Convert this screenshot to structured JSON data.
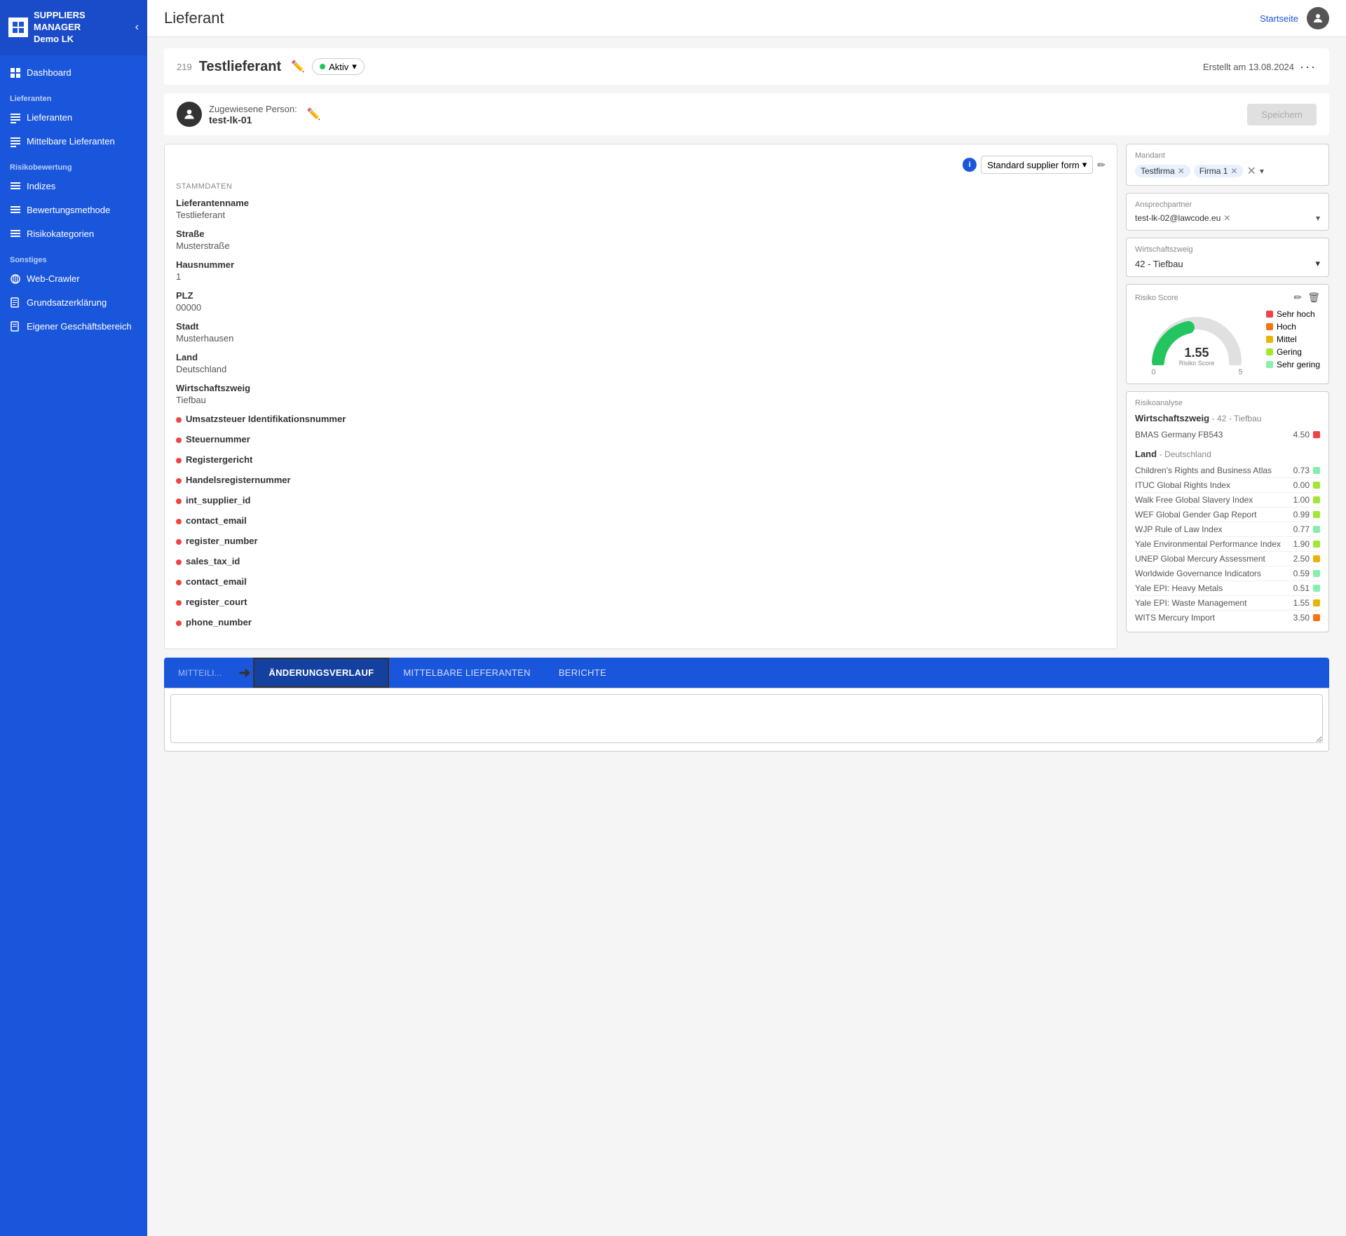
{
  "sidebar": {
    "app_name_line1": "SUPPLIERS",
    "app_name_line2": "MANAGER",
    "app_name_line3": "Demo LK",
    "collapse_icon": "‹",
    "nav": {
      "dashboard": "Dashboard",
      "section_lieferanten": "Lieferanten",
      "lieferanten": "Lieferanten",
      "mittelbare_lieferanten": "Mittelbare Lieferanten",
      "section_risikobewertung": "Risikobewertung",
      "indizes": "Indizes",
      "bewertungsmethode": "Bewertungsmethode",
      "risikokategorien": "Risikokategorien",
      "section_sonstiges": "Sonstiges",
      "web_crawler": "Web-Crawler",
      "grundsatzerklaerung": "Grundsatzerklärung",
      "eigener_geschaeftsbereich": "Eigener Geschäftsbereich"
    }
  },
  "topbar": {
    "title": "Lieferant",
    "link_startseite": "Startseite"
  },
  "supplier": {
    "id": "219",
    "name": "Testlieferant",
    "status": "Aktiv",
    "created_label": "Erstellt am 13.08.2024"
  },
  "assigned": {
    "label": "Zugewiesene Person:",
    "name": "test-lk-01"
  },
  "save_button": "Speichern",
  "form": {
    "section_label": "STAMMDATEN",
    "form_select_label": "Standard supplier form",
    "fields": [
      {
        "label": "Lieferantenname",
        "value": "Testlieferant",
        "required": false
      },
      {
        "label": "Straße",
        "value": "Musterstraße",
        "required": false
      },
      {
        "label": "Hausnummer",
        "value": "1",
        "required": false
      },
      {
        "label": "PLZ",
        "value": "00000",
        "required": false
      },
      {
        "label": "Stadt",
        "value": "Musterhausen",
        "required": false
      },
      {
        "label": "Land",
        "value": "Deutschland",
        "required": false
      },
      {
        "label": "Wirtschaftszweig",
        "value": "Tiefbau",
        "required": false
      }
    ],
    "required_fields": [
      "Umsatzsteuer Identifikationsnummer",
      "Steuernummer",
      "Registergericht",
      "Handelsregisternummer",
      "int_supplier_id",
      "contact_email",
      "register_number",
      "sales_tax_id",
      "contact_email",
      "register_court",
      "phone_number"
    ]
  },
  "right_panel": {
    "mandant_label": "Mandant",
    "mandant_tags": [
      "Testfirma",
      "Firma 1"
    ],
    "ansprechpartner_label": "Ansprechpartner",
    "ansprechpartner_value": "test-lk-02@lawcode.eu",
    "wirtschaftszweig_label": "Wirtschaftszweig",
    "wirtschaftszweig_value": "42 - Tiefbau",
    "risiko_score_label": "Risiko Score",
    "gauge_value": "1.55",
    "gauge_subtitle": "Risiko Score",
    "gauge_min": "0",
    "gauge_max": "5",
    "legend": [
      {
        "label": "Sehr hoch",
        "color": "#ef4444"
      },
      {
        "label": "Hoch",
        "color": "#f97316"
      },
      {
        "label": "Mittel",
        "color": "#eab308"
      },
      {
        "label": "Gering",
        "color": "#a3e635"
      },
      {
        "label": "Sehr gering",
        "color": "#86efac"
      }
    ],
    "risikoanalyse_label": "Risikoanalyse",
    "wirtschaftszweig_section": "Wirtschaftszweig",
    "wirtschaftszweig_section_sub": "42 - Tiefbau",
    "wirtschaftszweig_rows": [
      {
        "name": "BMAS Germany FB543",
        "value": "4.50",
        "color": "#ef4444"
      }
    ],
    "land_section": "Land",
    "land_section_sub": "Deutschland",
    "land_rows": [
      {
        "name": "Children's Rights and Business Atlas",
        "value": "0.73",
        "color": "#86efac"
      },
      {
        "name": "ITUC Global Rights Index",
        "value": "0.00",
        "color": "#a3e635"
      },
      {
        "name": "Walk Free Global Slavery Index",
        "value": "1.00",
        "color": "#a3e635"
      },
      {
        "name": "WEF Global Gender Gap Report",
        "value": "0.99",
        "color": "#a3e635"
      },
      {
        "name": "WJP Rule of Law Index",
        "value": "0.77",
        "color": "#86efac"
      },
      {
        "name": "Yale Environmental Performance Index",
        "value": "1.90",
        "color": "#a3e635"
      },
      {
        "name": "UNEP Global Mercury Assessment",
        "value": "2.50",
        "color": "#eab308"
      },
      {
        "name": "Worldwide Governance Indicators",
        "value": "0.59",
        "color": "#86efac"
      },
      {
        "name": "Yale EPI: Heavy Metals",
        "value": "0.51",
        "color": "#86efac"
      },
      {
        "name": "Yale EPI: Waste Management",
        "value": "1.55",
        "color": "#eab308"
      },
      {
        "name": "WITS Mercury Import",
        "value": "3.50",
        "color": "#f97316"
      }
    ]
  },
  "tabs": {
    "items": [
      {
        "label": "MITTEILI...",
        "id": "mitteili"
      },
      {
        "label": "ÄNDERUNGSVERLAUF",
        "id": "aenderungsverlauf",
        "active": true
      },
      {
        "label": "MITTELBARE LIEFERANTEN",
        "id": "mittelbare"
      },
      {
        "label": "BERICHTE",
        "id": "berichte"
      }
    ]
  },
  "textarea_placeholder": ""
}
